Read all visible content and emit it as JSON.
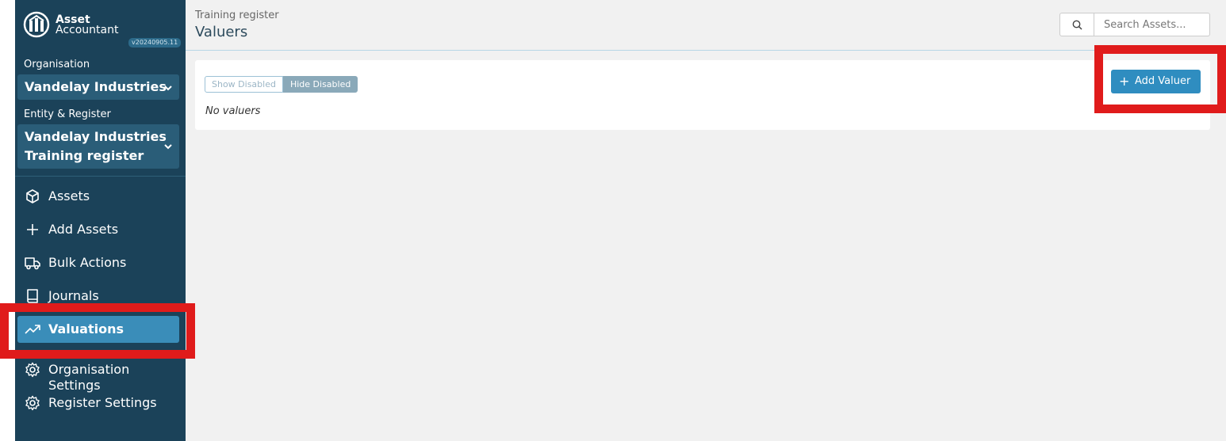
{
  "brand": {
    "name_line1": "Asset",
    "name_line2": "Accountant",
    "version": "v20240905.11"
  },
  "sidebar": {
    "organisation_label": "Organisation",
    "organisation_value": "Vandelay Industries",
    "entity_label": "Entity & Register",
    "entity_value_line1": "Vandelay Industries",
    "entity_value_line2": "Training register",
    "items": [
      {
        "label": "Assets",
        "icon": "cube-icon"
      },
      {
        "label": "Add Assets",
        "icon": "plus-icon"
      },
      {
        "label": "Bulk Actions",
        "icon": "truck-icon"
      },
      {
        "label": "Journals",
        "icon": "book-icon"
      },
      {
        "label": "Valuations",
        "icon": "trending-up-icon",
        "active": true
      },
      {
        "label": "Organisation Settings",
        "icon": "gear-icon"
      },
      {
        "label": "Register Settings",
        "icon": "gear-icon"
      }
    ]
  },
  "header": {
    "breadcrumb": "Training register",
    "title": "Valuers",
    "search_placeholder": "Search Assets..."
  },
  "main": {
    "toggle": {
      "show_disabled": "Show Disabled",
      "hide_disabled": "Hide Disabled",
      "selected": "Hide Disabled"
    },
    "empty_message": "No valuers",
    "add_button_label": "Add Valuer"
  },
  "colors": {
    "sidebar_bg": "#1b4259",
    "active_item": "#3a8db9",
    "primary_button": "#2f8dc0",
    "highlight": "#e01b1b"
  }
}
